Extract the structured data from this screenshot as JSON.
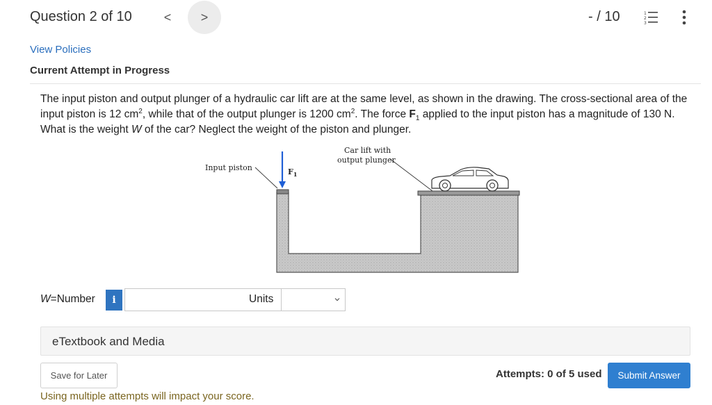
{
  "header": {
    "question_title": "Question 2 of 10",
    "prev_label": "<",
    "next_label": ">",
    "score": "- / 10",
    "icons": [
      "list-icon",
      "more-vertical-icon"
    ]
  },
  "links": {
    "policies": "View Policies"
  },
  "status": {
    "attempt": "Current Attempt in Progress"
  },
  "question": {
    "text_1": "The input piston and output plunger of a hydraulic car lift are at the same level, as shown in the drawing. The cross-sectional area of the input piston is 12 cm",
    "sup_1": "2",
    "text_2": ", while that of the output plunger is 1200 cm",
    "sup_2": "2",
    "text_3": ". The force ",
    "force_symbol": "F",
    "force_sub": "1",
    "text_4": " applied to the input piston has a magnitude of 130 N. What is the weight ",
    "weight_symbol": "W",
    "text_5": " of the car? Neglect the weight of the piston and plunger."
  },
  "figure": {
    "input_label": "Input piston",
    "force_label": "F",
    "force_label_sub": "1",
    "car_label_line1": "Car lift with",
    "car_label_line2": "output plunger"
  },
  "answer": {
    "var_label": "W",
    "equals_label": "=Number",
    "info_label": "i",
    "number_value": "",
    "units_label": "Units",
    "units_value": ""
  },
  "etextbook": {
    "label": "eTextbook and Media"
  },
  "footer": {
    "save_label": "Save for Later",
    "attempts_label": "Attempts: 0 of 5 used",
    "submit_label": "Submit Answer",
    "warning": "Using multiple attempts will impact your score."
  },
  "colors": {
    "link": "#2a6ebd",
    "primary_button": "#2f7fd0",
    "info_button": "#2f74c0",
    "warning_text": "#7a6520",
    "force_arrow": "#1f5fd6"
  }
}
